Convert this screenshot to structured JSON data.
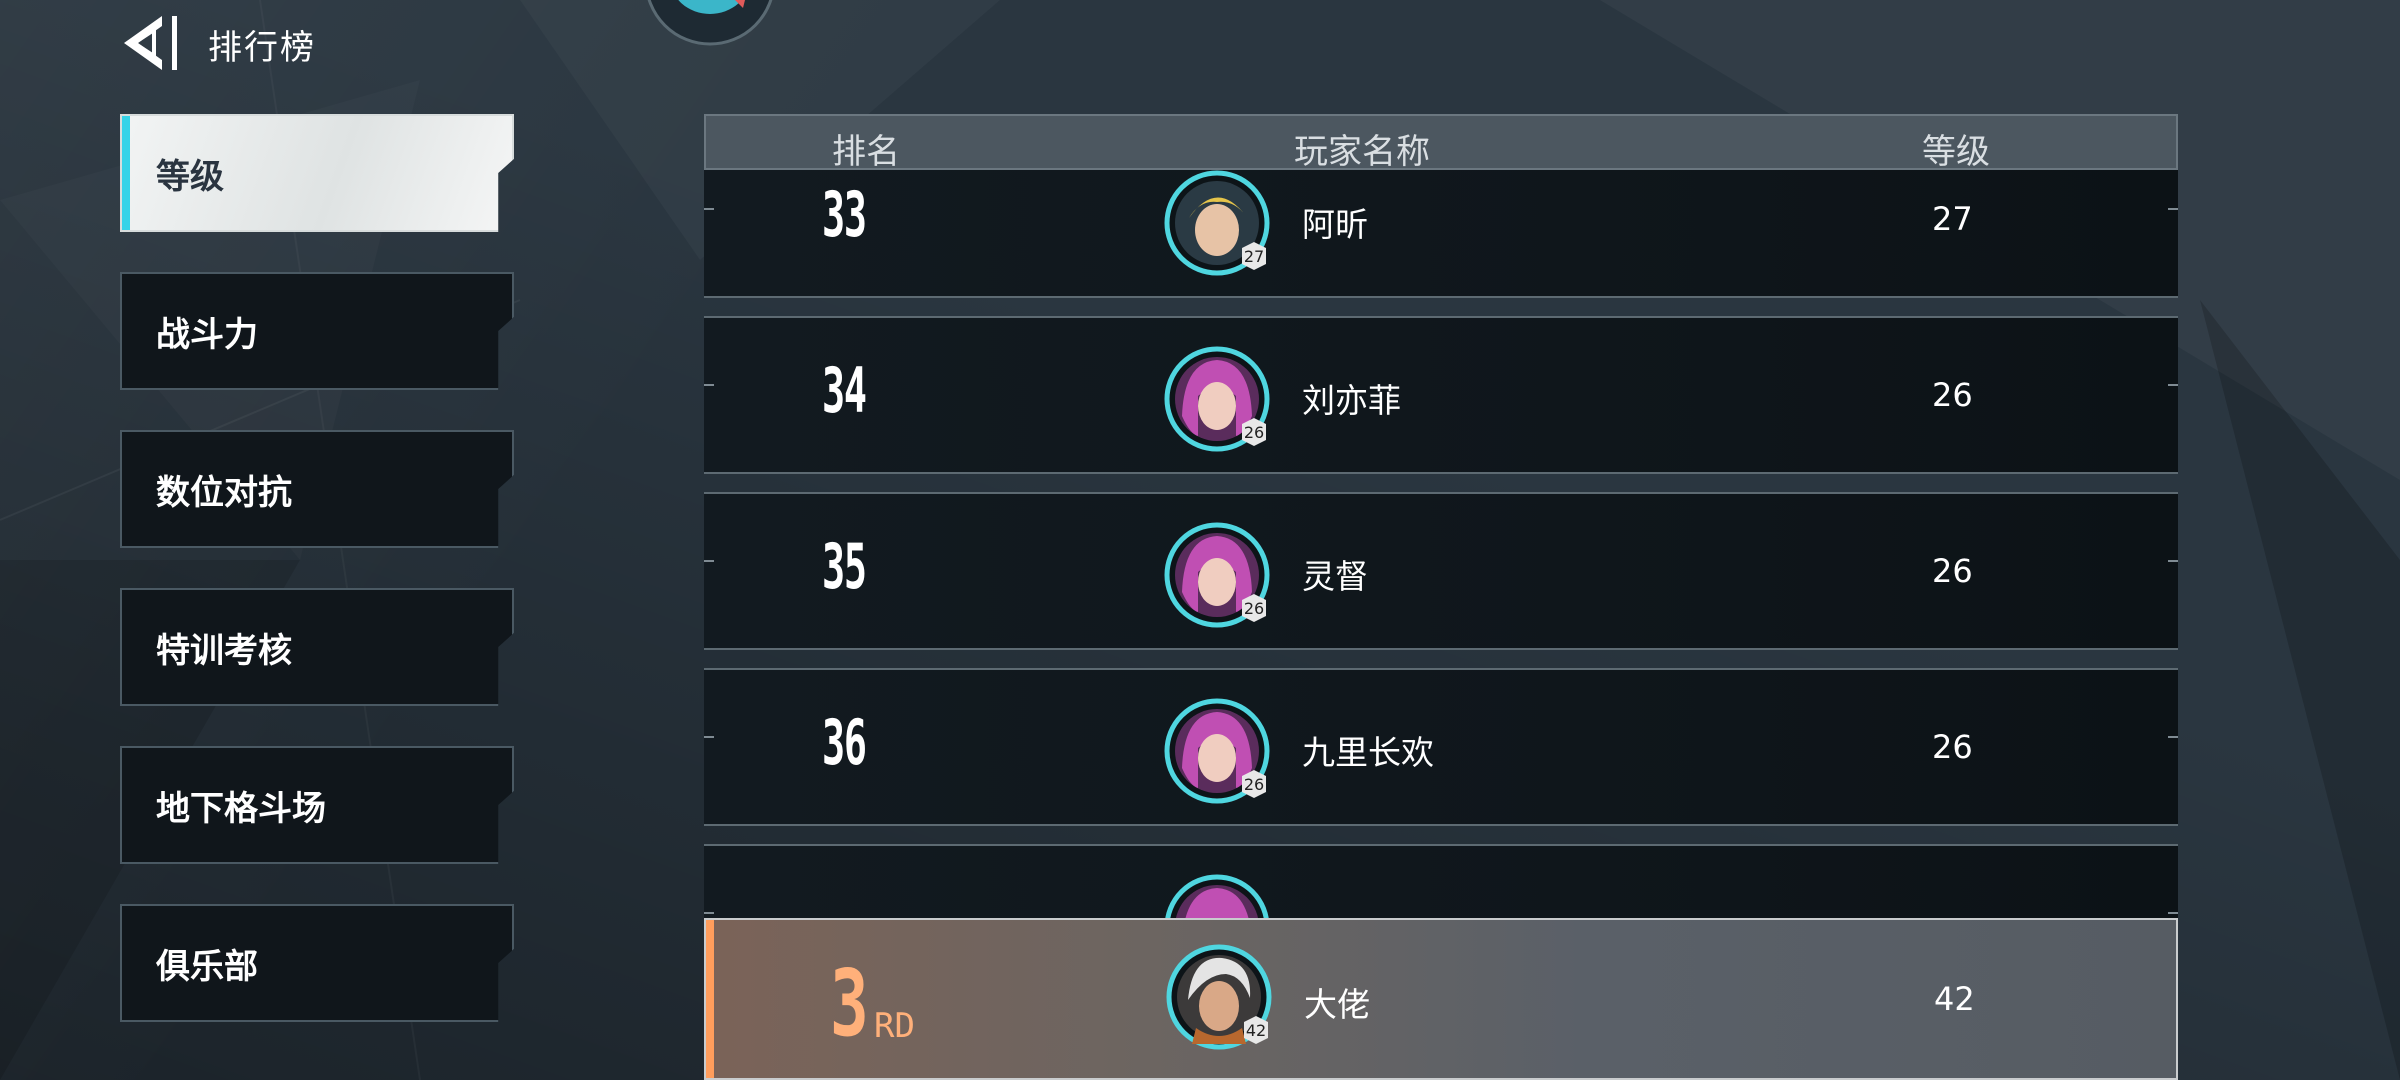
{
  "header": {
    "title": "排行榜",
    "back_icon": "back-arrow-icon"
  },
  "sidebar": {
    "items": [
      {
        "label": "等级",
        "active": true
      },
      {
        "label": "战斗力",
        "active": false
      },
      {
        "label": "数位对抗",
        "active": false
      },
      {
        "label": "特训考核",
        "active": false
      },
      {
        "label": "地下格斗场",
        "active": false
      },
      {
        "label": "俱乐部",
        "active": false
      }
    ]
  },
  "table": {
    "columns": {
      "rank": "排名",
      "name": "玩家名称",
      "level": "等级"
    },
    "rows": [
      {
        "rank": "33",
        "name": "阿昕",
        "level": "27",
        "avatar_level": "27",
        "avatar": "blonde-hero"
      },
      {
        "rank": "34",
        "name": "刘亦菲",
        "level": "26",
        "avatar_level": "26",
        "avatar": "pink-hair-girl"
      },
      {
        "rank": "35",
        "name": "灵督",
        "level": "26",
        "avatar_level": "26",
        "avatar": "pink-hair-girl"
      },
      {
        "rank": "36",
        "name": "九里长欢",
        "level": "26",
        "avatar_level": "26",
        "avatar": "pink-hair-girl"
      }
    ]
  },
  "my_rank": {
    "rank": "3",
    "suffix": "RD",
    "name": "大佬",
    "level": "42",
    "avatar_level": "42",
    "avatar": "white-hair-hero"
  },
  "colors": {
    "accent_cyan": "#35d3e8",
    "accent_orange": "#ff9d5c"
  }
}
